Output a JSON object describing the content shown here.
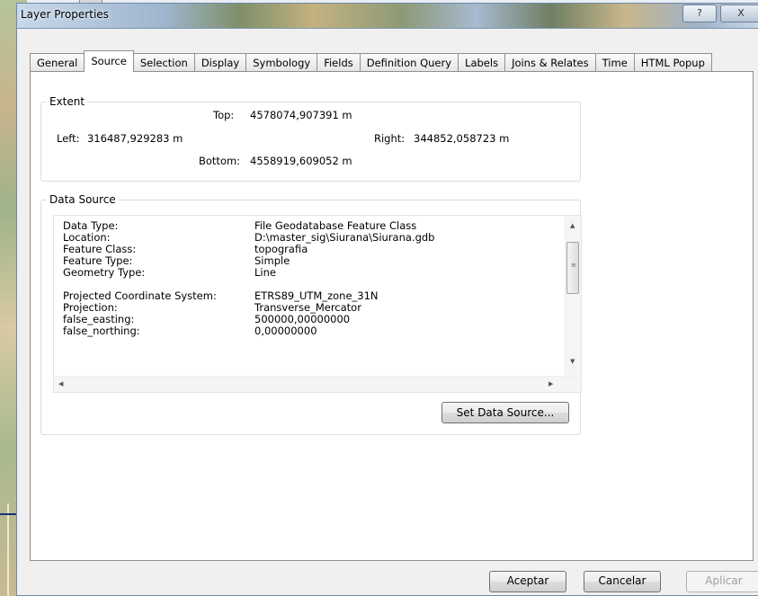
{
  "window": {
    "title": "Layer Properties",
    "help_glyph": "?",
    "close_glyph": "X"
  },
  "tabs": [
    {
      "label": "General",
      "active": false
    },
    {
      "label": "Source",
      "active": true
    },
    {
      "label": "Selection",
      "active": false
    },
    {
      "label": "Display",
      "active": false
    },
    {
      "label": "Symbology",
      "active": false
    },
    {
      "label": "Fields",
      "active": false
    },
    {
      "label": "Definition Query",
      "active": false
    },
    {
      "label": "Labels",
      "active": false
    },
    {
      "label": "Joins & Relates",
      "active": false
    },
    {
      "label": "Time",
      "active": false
    },
    {
      "label": "HTML Popup",
      "active": false
    }
  ],
  "extent": {
    "title": "Extent",
    "top_label": "Top:",
    "top_value": "4578074,907391 m",
    "left_label": "Left:",
    "left_value": "316487,929283 m",
    "right_label": "Right:",
    "right_value": "344852,058723 m",
    "bottom_label": "Bottom:",
    "bottom_value": "4558919,609052 m"
  },
  "data_source": {
    "title": "Data Source",
    "rows": [
      {
        "key": "Data Type:",
        "value": "File Geodatabase Feature Class"
      },
      {
        "key": "Location:",
        "value": "D:\\master_sig\\Siurana\\Siurana.gdb"
      },
      {
        "key": "Feature Class:",
        "value": "topografia"
      },
      {
        "key": "Feature Type:",
        "value": "Simple"
      },
      {
        "key": "Geometry Type:",
        "value": "Line"
      },
      {
        "key": "Projected Coordinate System:",
        "value": "ETRS89_UTM_zone_31N"
      },
      {
        "key": "Projection:",
        "value": "Transverse_Mercator"
      },
      {
        "key": "false_easting:",
        "value": "500000,00000000"
      },
      {
        "key": "false_northing:",
        "value": "0,00000000"
      }
    ],
    "set_button": "Set Data Source..."
  },
  "footer": {
    "ok": "Aceptar",
    "cancel": "Cancelar",
    "apply": "Aplicar"
  }
}
